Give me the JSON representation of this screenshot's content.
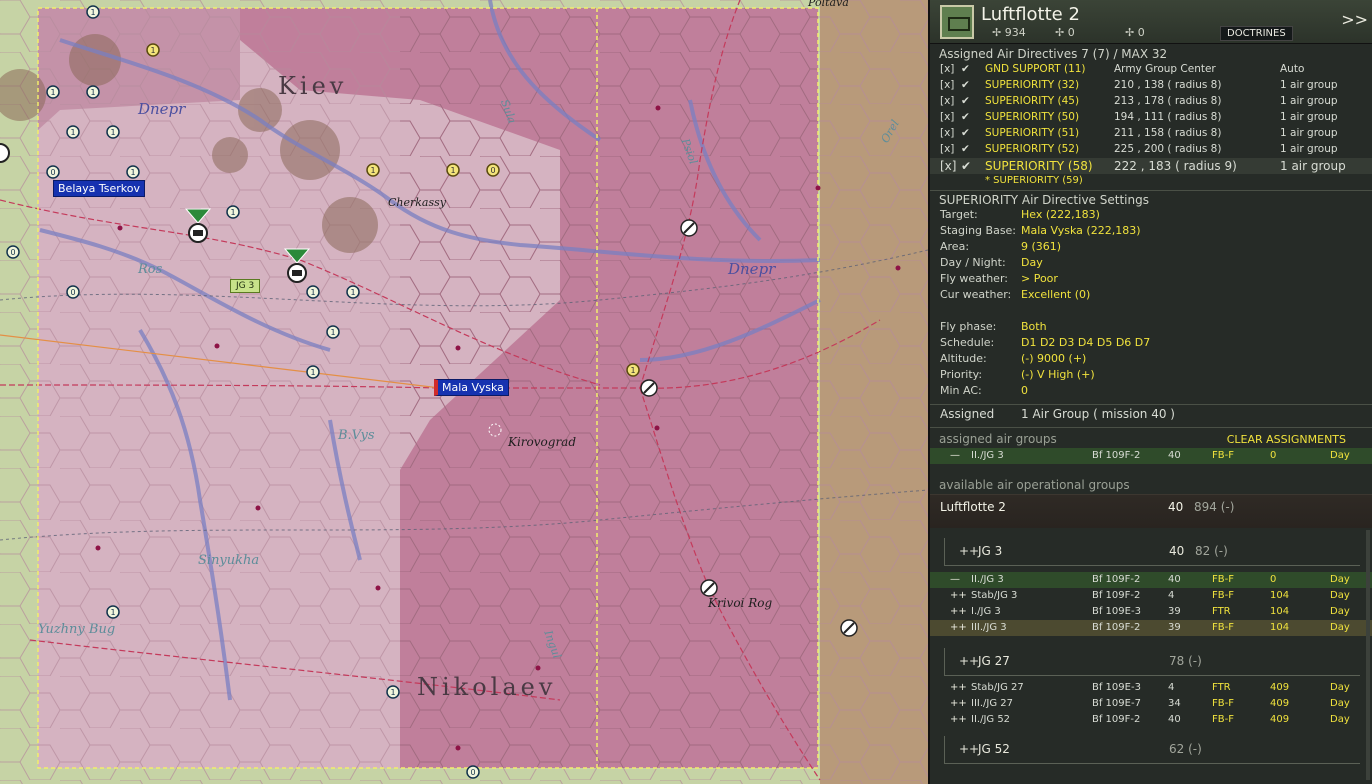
{
  "map": {
    "regions": [
      "Kiev",
      "Nikolaev"
    ],
    "rivers": [
      "Dnepr",
      "Dnepr",
      "Ros",
      "Sinyukha",
      "Yuzhny Bug",
      "B.Vys",
      "Ingul",
      "Psiol",
      "Sula",
      "Orel"
    ],
    "cities": {
      "cherkassy": "Cherkassy",
      "kirovograd": "Kirovograd",
      "krivoi_rog": "Krivoi Rog",
      "poltava": "Poltava"
    },
    "city_tags": {
      "belaya_tserkov": "Belaya Tserkov",
      "mala_vyska": "Mala Vyska"
    },
    "unit_tag": "JG 3"
  },
  "panel": {
    "title": "Luftflotte 2",
    "stats": [
      "934",
      "0",
      "0"
    ],
    "doctrines": "DOCTRINES",
    "more": ">>",
    "directives_header": "Assigned Air Directives 7 (7) / MAX 32",
    "directives": [
      {
        "check": "[x]",
        "name": "GND SUPPORT (11)",
        "target": "Army Group Center",
        "mode": "Auto"
      },
      {
        "check": "[x]",
        "name": "SUPERIORITY (32)",
        "target": "210 , 138 ( radius 8)",
        "mode": "1 air group"
      },
      {
        "check": "[x]",
        "name": "SUPERIORITY (45)",
        "target": "213 , 178 ( radius 8)",
        "mode": "1 air group"
      },
      {
        "check": "[x]",
        "name": "SUPERIORITY (50)",
        "target": "194 , 111 ( radius 8)",
        "mode": "1 air group"
      },
      {
        "check": "[x]",
        "name": "SUPERIORITY (51)",
        "target": "211 , 158 ( radius 8)",
        "mode": "1 air group"
      },
      {
        "check": "[x]",
        "name": "SUPERIORITY (52)",
        "target": "225 , 200 ( radius 8)",
        "mode": "1 air group"
      },
      {
        "check": "[x]",
        "name": "SUPERIORITY (58)",
        "target": "222 , 183 ( radius 9)",
        "mode": "1 air group"
      }
    ],
    "directive_partial": "* SUPERIORITY (59)",
    "settings_title": "SUPERIORITY Air Directive Settings",
    "settings": [
      {
        "k": "Target:",
        "v": "Hex (222,183)"
      },
      {
        "k": "Staging Base:",
        "v": "Mala Vyska (222,183)"
      },
      {
        "k": "Area:",
        "v": "9 (361)"
      },
      {
        "k": "Day / Night:",
        "v": "Day"
      },
      {
        "k": "Fly weather:",
        "v": "> Poor"
      },
      {
        "k": "Cur weather:",
        "v": "Excellent (0)"
      }
    ],
    "settings2": [
      {
        "k": "Fly phase:",
        "v": "Both"
      },
      {
        "k": "Schedule:",
        "v": "D1  D2  D3  D4  D5  D6  D7"
      },
      {
        "k": "Altitude:",
        "v": "(-)  9000  (+)"
      },
      {
        "k": "Priority:",
        "v": "(-)  V High  (+)"
      },
      {
        "k": "Min AC:",
        "v": "0"
      }
    ],
    "assigned_label": "Assigned",
    "assigned_value": "1 Air Group  ( mission 40 )",
    "assigned_groups_title": "assigned air groups",
    "clear_assignments": "CLEAR ASSIGNMENTS",
    "assigned_groups": [
      {
        "pm": "—",
        "name": "II./JG 3",
        "ac": "Bf 109F-2",
        "n": "40",
        "role": "FB-F",
        "val": "0",
        "time": "Day"
      }
    ],
    "available_title": "available air operational groups",
    "luftflotte": {
      "name": "Luftflotte 2",
      "n": "40",
      "total": "894 (-)"
    },
    "jg3": {
      "pm": "++",
      "name": "JG 3",
      "n": "40",
      "total": "82 (-)"
    },
    "jg3_groups": [
      {
        "pm": "—",
        "name": "II./JG 3",
        "ac": "Bf 109F-2",
        "n": "40",
        "role": "FB-F",
        "val": "0",
        "time": "Day"
      },
      {
        "pm": "++",
        "name": "Stab/JG 3",
        "ac": "Bf 109F-2",
        "n": "4",
        "role": "FB-F",
        "val": "104",
        "time": "Day"
      },
      {
        "pm": "++",
        "name": "I./JG 3",
        "ac": "Bf 109E-3",
        "n": "39",
        "role": "FTR",
        "val": "104",
        "time": "Day"
      },
      {
        "pm": "++",
        "name": "III./JG 3",
        "ac": "Bf 109F-2",
        "n": "39",
        "role": "FB-F",
        "val": "104",
        "time": "Day"
      }
    ],
    "jg27": {
      "pm": "++",
      "name": "JG 27",
      "total": "78 (-)"
    },
    "jg27_groups": [
      {
        "pm": "++",
        "name": "Stab/JG 27",
        "ac": "Bf 109E-3",
        "n": "4",
        "role": "FTR",
        "val": "409",
        "time": "Day"
      },
      {
        "pm": "++",
        "name": "III./JG 27",
        "ac": "Bf 109E-7",
        "n": "34",
        "role": "FB-F",
        "val": "409",
        "time": "Day"
      },
      {
        "pm": "++",
        "name": "II./JG 52",
        "ac": "Bf 109F-2",
        "n": "40",
        "role": "FB-F",
        "val": "409",
        "time": "Day"
      }
    ],
    "jg52": {
      "pm": "++",
      "name": "JG 52",
      "total": "62 (-)"
    }
  }
}
